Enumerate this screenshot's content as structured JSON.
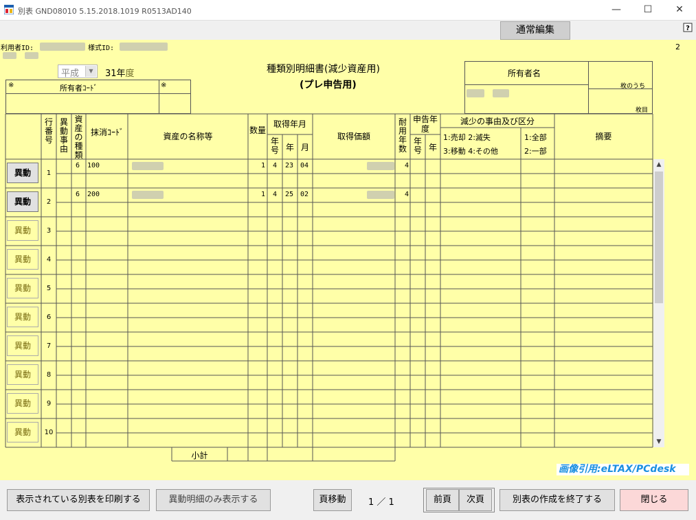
{
  "window": {
    "title": "別表 GND08010  5.15.2018.1019  R0513AD140",
    "minimize": "—",
    "maximize": "☐",
    "close": "✕"
  },
  "toolbar": {
    "mode_button": "通常編集"
  },
  "header": {
    "user_id_label": "利用者ID:",
    "form_id_label": "様式ID:",
    "page_number": "2",
    "era_value": "平成",
    "year_value": "31年",
    "year_suffix": "度",
    "form_title": "種類別明細書(減少資産用)",
    "form_subtitle": "(プレ申告用)",
    "owner_code_mark1": "※",
    "owner_code_label": "所有者ｺｰﾄﾞ",
    "owner_code_mark2": "※",
    "owner_name_label": "所有者名",
    "sheet_of": "枚のうち",
    "sheet_no": "枚目"
  },
  "columns": {
    "row_no": "行番号",
    "change_reason": "異動事由",
    "asset_type": "資産の種類",
    "deletion_code": "抹消ｺｰﾄﾞ",
    "asset_name": "資産の名称等",
    "quantity": "数量",
    "acq_date": "取得年月",
    "acq_era": "年号",
    "acq_year": "年",
    "acq_month": "月",
    "acq_price": "取得価額",
    "useful_life": "耐用年数",
    "decl_year": "申告年度",
    "decl_era": "年号",
    "decl_yr": "年",
    "reduction_title": "減少の事由及び区分",
    "reduction_opts1": "1:売却 2:滅失",
    "reduction_opts2": "3:移動 4:その他",
    "scope_opts1": "1:全部",
    "scope_opts2": "2:一部",
    "remarks": "摘要"
  },
  "rows": [
    {
      "button": "異動",
      "no": "1",
      "type": "6",
      "code": "100",
      "qty": "1",
      "era": "4",
      "year": "23",
      "month": "04",
      "life": "4",
      "active": true
    },
    {
      "button": "異動",
      "no": "2",
      "type": "6",
      "code": "200",
      "qty": "1",
      "era": "4",
      "year": "25",
      "month": "02",
      "life": "4",
      "active": true
    },
    {
      "button": "異動",
      "no": "3"
    },
    {
      "button": "異動",
      "no": "4"
    },
    {
      "button": "異動",
      "no": "5"
    },
    {
      "button": "異動",
      "no": "6"
    },
    {
      "button": "異動",
      "no": "7"
    },
    {
      "button": "異動",
      "no": "8"
    },
    {
      "button": "異動",
      "no": "9"
    },
    {
      "button": "異動",
      "no": "10"
    }
  ],
  "subtotal_label": "小計",
  "credit": "画像引用:eLTAX/PCdesk",
  "footer": {
    "print_button": "表示されている別表を印刷する",
    "show_changes_button": "異動明細のみ表示する",
    "page_move_button": "頁移動",
    "pager": "1 ／ 1",
    "prev_button": "前頁",
    "next_button": "次頁",
    "finish_button": "別表の作成を終了する",
    "close_button": "閉じる"
  },
  "colors": {
    "background": "#ffffa8",
    "close_button": "#fcd8d8",
    "credit_text": "#1a8fe0"
  }
}
